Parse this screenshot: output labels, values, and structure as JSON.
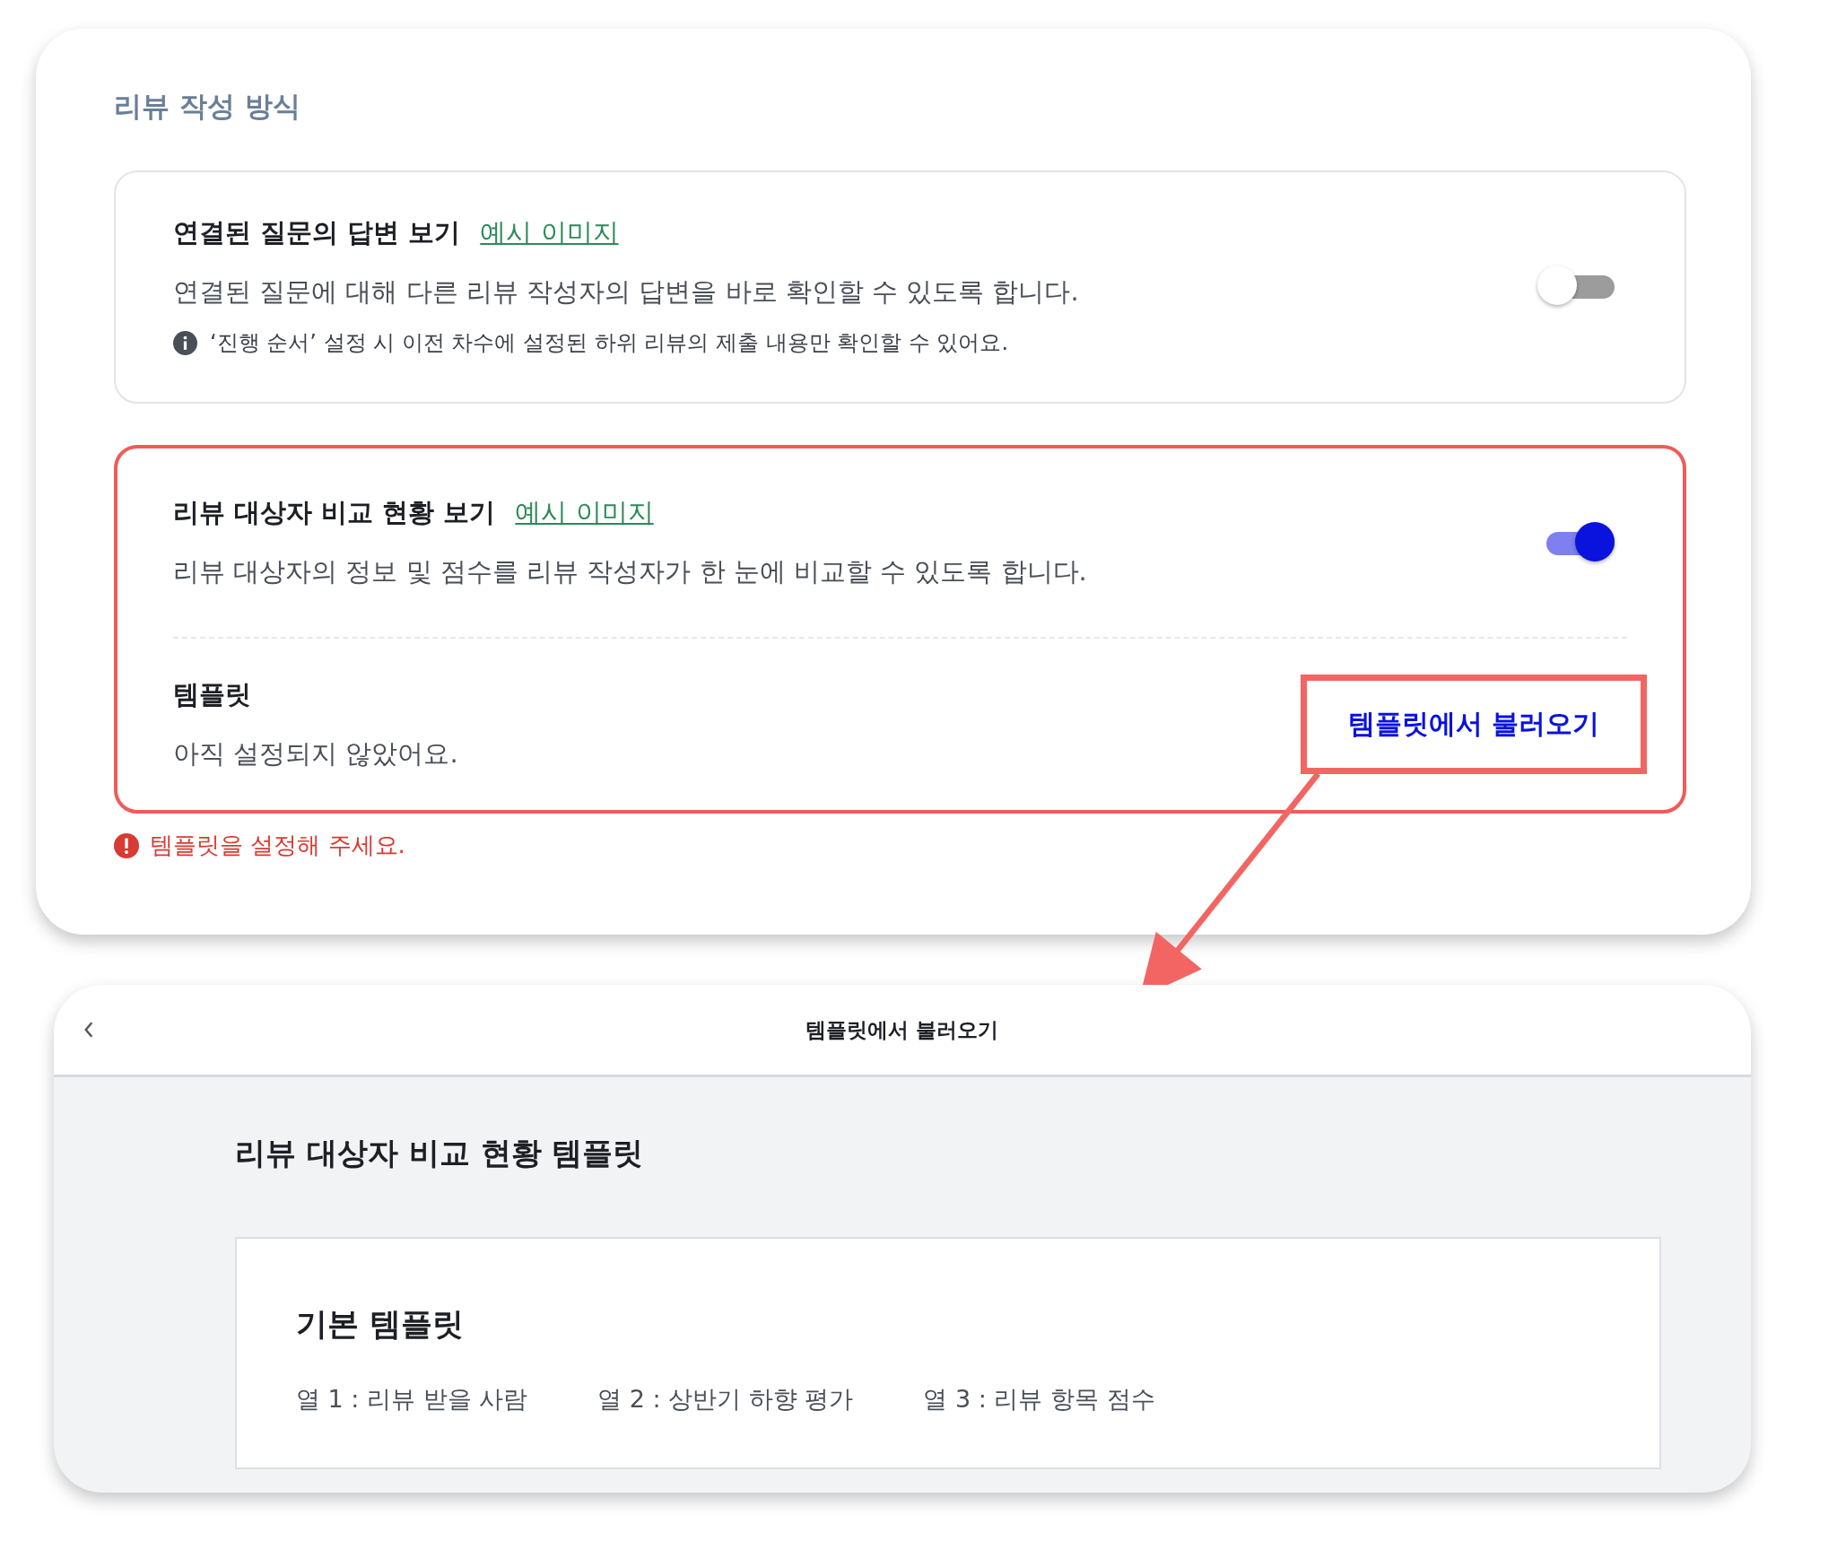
{
  "section": {
    "title": "리뷰 작성 방식",
    "options": [
      {
        "title": "연결된 질문의 답변 보기",
        "link": "예시 이미지",
        "description": "연결된 질문에 대해 다른 리뷰 작성자의 답변을 바로 확인할 수 있도록 합니다.",
        "note": "‘진행 순서’ 설정 시 이전 차수에 설정된 하위 리뷰의 제출 내용만 확인할 수 있어요.",
        "on": false,
        "highlighted": false
      },
      {
        "title": "리뷰 대상자 비교 현황 보기",
        "link": "예시 이미지",
        "description": "리뷰 대상자의 정보 및 점수를 리뷰 작성자가 한 눈에 비교할 수 있도록 합니다.",
        "on": true,
        "highlighted": true,
        "template": {
          "label": "템플릿",
          "value": "아직 설정되지 않았어요.",
          "button": "템플릿에서 불러오기",
          "button_highlighted": true
        }
      }
    ],
    "error": "템플릿을 설정해 주세요."
  },
  "dialog": {
    "title": "템플릿에서 불러오기",
    "heading": "리뷰 대상자 비교 현황 템플릿",
    "templates": [
      {
        "name": "기본 템플릿",
        "columns": [
          "열 1 : 리뷰 받을 사람",
          "열 2 : 상반기 하향 평가",
          "열 3 : 리뷰 항목 점수"
        ]
      }
    ]
  }
}
